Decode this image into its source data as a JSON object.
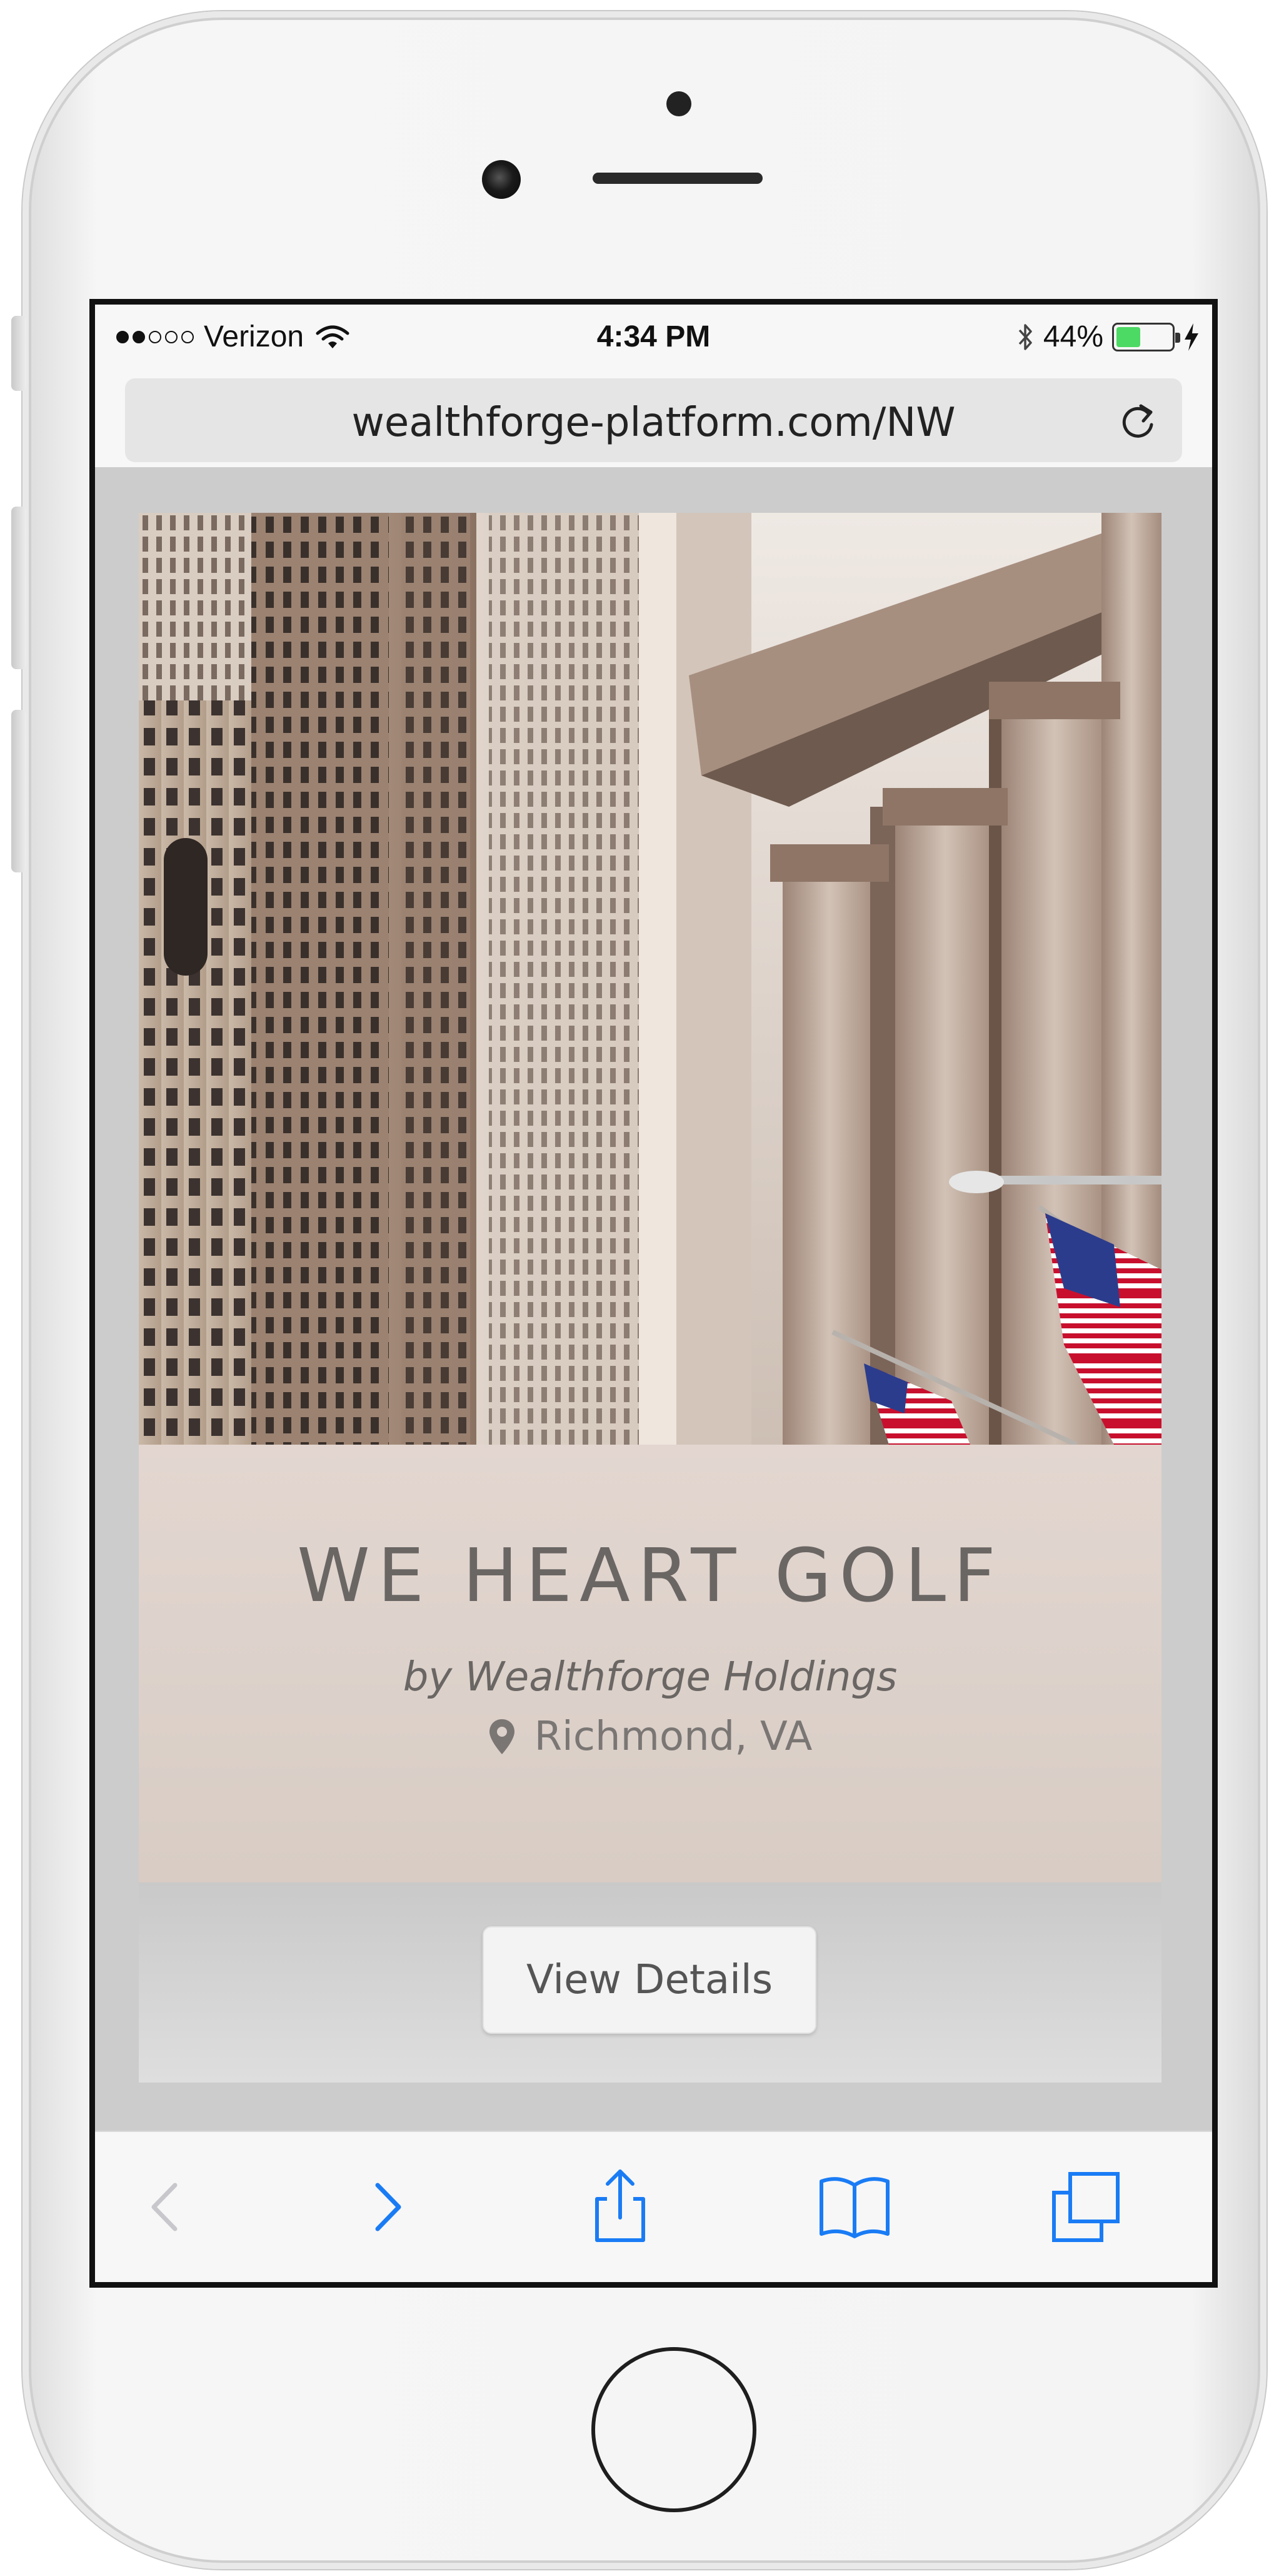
{
  "status_bar": {
    "carrier": "Verizon",
    "time": "4:34 PM",
    "battery": "44%",
    "battery_level": 0.44
  },
  "browser": {
    "url": "wealthforge-platform.com/NW"
  },
  "listing": {
    "title": "WE HEART GOLF",
    "byline": "by Wealthforge Holdings",
    "location": "Richmond, VA",
    "button_label": "View Details"
  },
  "colors": {
    "accent_blue": "#1a7cf5",
    "battery_green": "#4cd964",
    "page_background": "#cccccc"
  },
  "icons": {
    "reload": "reload-icon",
    "location": "map-pin-icon",
    "back": "chevron-left-icon",
    "forward": "chevron-right-icon",
    "share": "share-icon",
    "bookmarks": "book-icon",
    "tabs": "tabs-icon"
  }
}
